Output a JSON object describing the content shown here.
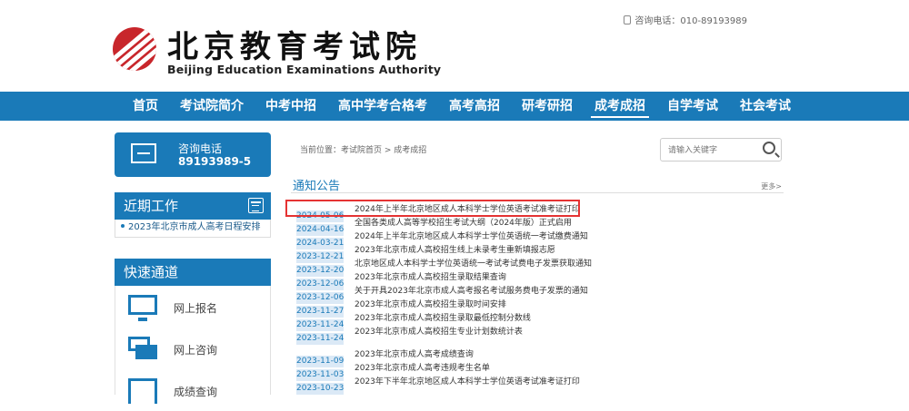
{
  "header": {
    "logo_cn": "北京教育考试院",
    "logo_en": "Beijing Education Examinations Authority",
    "phone": "咨询电话：010-89193989"
  },
  "nav": {
    "items": [
      "首页",
      "考试院简介",
      "中考中招",
      "高中学考合格考",
      "高考高招",
      "研考研招",
      "成考成招",
      "自学考试",
      "社会考试"
    ],
    "active_index": 6
  },
  "sidebar": {
    "hotline": {
      "label": "咨询电话",
      "number": "89193989-5"
    },
    "recent": {
      "title": "近期工作",
      "items": [
        "2023年北京市成人高考日程安排"
      ]
    },
    "quick": {
      "title": "快速通道",
      "items": [
        {
          "label": "网上报名",
          "icon": "monitor-icon"
        },
        {
          "label": "网上咨询",
          "icon": "chat-icon"
        },
        {
          "label": "成绩查询",
          "icon": "book-icon"
        }
      ]
    }
  },
  "main": {
    "breadcrumb": "当前位置：考试院首页 > 成考成招",
    "search_placeholder": "请输入关键字",
    "section_title": "通知公告",
    "more": "更多>",
    "notices": [
      {
        "date": "2024-05-06",
        "title": "2024年上半年北京地区成人本科学士学位英语考试准考证打印",
        "highlighted": true
      },
      {
        "date": "2024-04-16",
        "title": "全国各类成人高等学校招生考试大纲（2024年版）正式启用"
      },
      {
        "date": "2024-03-21",
        "title": "2024年上半年北京地区成人本科学士学位英语统一考试缴费通知"
      },
      {
        "date": "2023-12-21",
        "title": "2023年北京市成人高校招生线上未录考生重新填报志愿"
      },
      {
        "date": "2023-12-20",
        "title": "北京地区成人本科学士学位英语统一考试考试费电子发票获取通知"
      },
      {
        "date": "2023-12-06",
        "title": "2023年北京市成人高校招生录取结果查询"
      },
      {
        "date": "2023-12-06",
        "title": "关于开具2023年北京市成人高考报名考试服务费电子发票的通知"
      },
      {
        "date": "2023-11-27",
        "title": "2023年北京市成人高校招生录取时间安排"
      },
      {
        "date": "2023-11-24",
        "title": "2023年北京市成人高校招生录取最低控制分数线"
      },
      {
        "date": "2023-11-24",
        "title": "2023年北京市成人高校招生专业计划数统计表"
      },
      {
        "date": "2023-11-09",
        "title": "2023年北京市成人高考成绩查询"
      },
      {
        "date": "2023-11-03",
        "title": "2023年北京市成人高考违规考生名单"
      },
      {
        "date": "2023-10-23",
        "title": "2023年下半年北京地区成人本科学士学位英语考试准考证打印"
      }
    ]
  }
}
